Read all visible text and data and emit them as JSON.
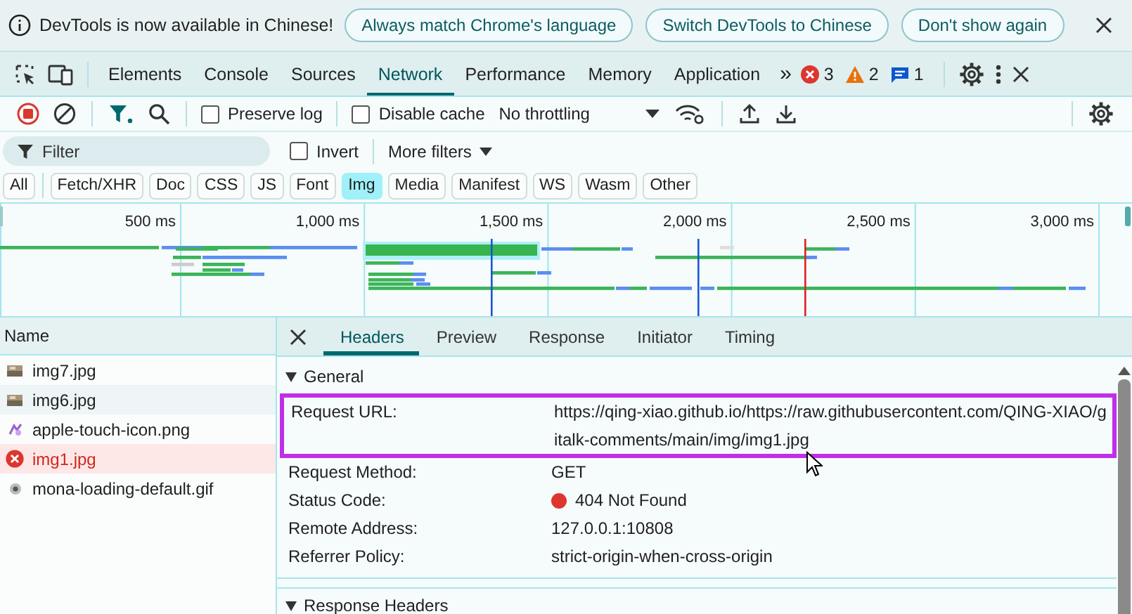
{
  "infobar": {
    "message": "DevTools is now available in Chinese!",
    "buttons": [
      "Always match Chrome's language",
      "Switch DevTools to Chinese",
      "Don't show again"
    ]
  },
  "tabs": [
    {
      "label": "Elements",
      "selected": false
    },
    {
      "label": "Console",
      "selected": false
    },
    {
      "label": "Sources",
      "selected": false
    },
    {
      "label": "Network",
      "selected": true
    },
    {
      "label": "Performance",
      "selected": false
    },
    {
      "label": "Memory",
      "selected": false
    },
    {
      "label": "Application",
      "selected": false
    }
  ],
  "more_tabs": "»",
  "counters": [
    {
      "kind": "error",
      "count": "3"
    },
    {
      "kind": "warning",
      "count": "2"
    },
    {
      "kind": "message",
      "count": "1"
    }
  ],
  "toolbar": {
    "recording": true,
    "preserve_log": {
      "label": "Preserve log",
      "checked": false
    },
    "disable_cache": {
      "label": "Disable cache",
      "checked": false
    },
    "throttling": "No throttling"
  },
  "filter": {
    "placeholder": "Filter",
    "invert": {
      "label": "Invert",
      "checked": false
    },
    "more_filters": "More filters"
  },
  "type_filters": [
    {
      "label": "All",
      "selected": false
    },
    {
      "label": "Fetch/XHR",
      "selected": false
    },
    {
      "label": "Doc",
      "selected": false
    },
    {
      "label": "CSS",
      "selected": false
    },
    {
      "label": "JS",
      "selected": false
    },
    {
      "label": "Font",
      "selected": false
    },
    {
      "label": "Img",
      "selected": true
    },
    {
      "label": "Media",
      "selected": false
    },
    {
      "label": "Manifest",
      "selected": false
    },
    {
      "label": "WS",
      "selected": false
    },
    {
      "label": "Wasm",
      "selected": false
    },
    {
      "label": "Other",
      "selected": false
    }
  ],
  "overview": {
    "ticks": [
      "500 ms",
      "1,000 ms",
      "1,500 ms",
      "2,000 ms",
      "2,500 ms",
      "3,000 ms"
    ]
  },
  "requests": {
    "column": "Name",
    "rows": [
      {
        "name": "img7.jpg",
        "kind": "photo",
        "selected": false
      },
      {
        "name": "img6.jpg",
        "kind": "photo",
        "selected": false
      },
      {
        "name": "apple-touch-icon.png",
        "kind": "sprite",
        "selected": false
      },
      {
        "name": "img1.jpg",
        "kind": "error",
        "selected": true
      },
      {
        "name": "mona-loading-default.gif",
        "kind": "gif",
        "selected": false
      }
    ]
  },
  "details": {
    "tabs": [
      {
        "label": "Headers",
        "selected": true
      },
      {
        "label": "Preview",
        "selected": false
      },
      {
        "label": "Response",
        "selected": false
      },
      {
        "label": "Initiator",
        "selected": false
      },
      {
        "label": "Timing",
        "selected": false
      }
    ],
    "sections": [
      {
        "title": "General",
        "expanded": true,
        "rows": [
          {
            "label": "Request URL:",
            "value": "https://qing-xiao.github.io/https://raw.githubusercontent.com/QING-XIAO/gitalk-comments/main/img/img1.jpg",
            "highlighted": true,
            "kind": "text"
          },
          {
            "label": "Request Method:",
            "value": "GET",
            "highlighted": false,
            "kind": "text"
          },
          {
            "label": "Status Code:",
            "value": "404 Not Found",
            "highlighted": false,
            "kind": "status"
          },
          {
            "label": "Remote Address:",
            "value": "127.0.0.1:10808",
            "highlighted": false,
            "kind": "text"
          },
          {
            "label": "Referrer Policy:",
            "value": "strict-origin-when-cross-origin",
            "highlighted": false,
            "kind": "text"
          }
        ]
      },
      {
        "title": "Response Headers",
        "expanded": true
      }
    ]
  }
}
